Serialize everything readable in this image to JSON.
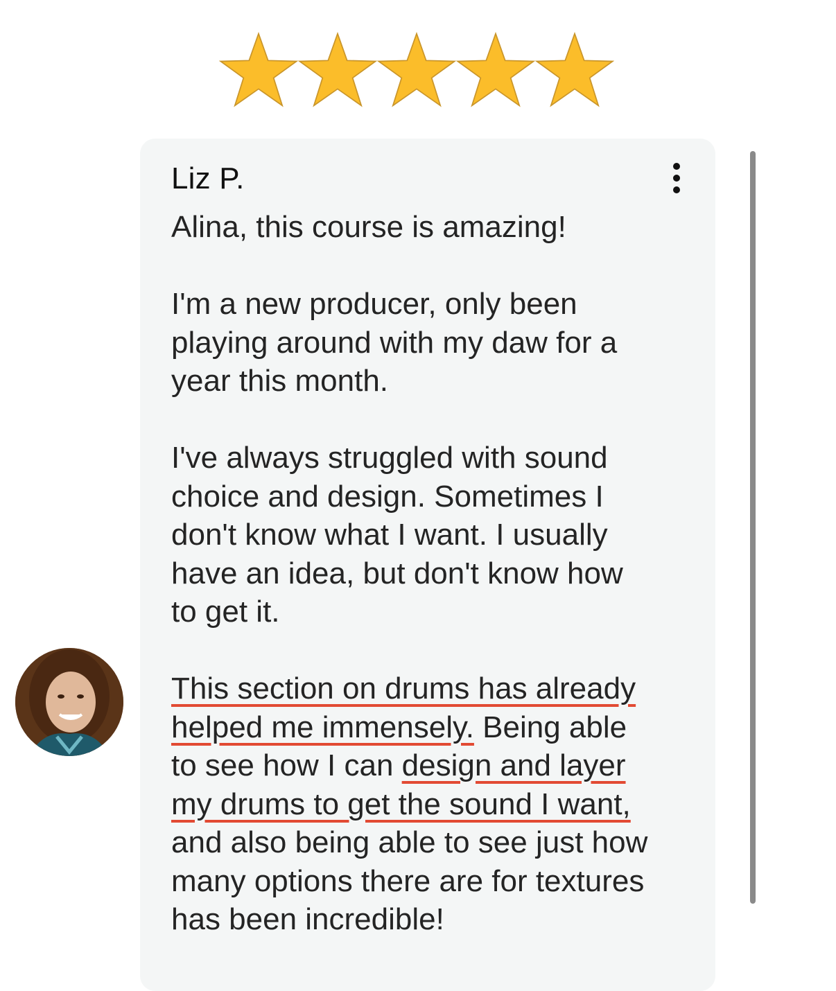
{
  "rating": {
    "stars_filled": 5,
    "stars_total": 5,
    "star_color": "#fbbd2a"
  },
  "review": {
    "author": "Liz P.",
    "menu_icon": "more-vertical-icon",
    "lines": [
      "Alina, this course is amazing!",
      "I'm a new producer, only been",
      "playing around with my daw for a",
      "year this month.",
      "I've always struggled with sound",
      "choice and design. Sometimes I",
      "don't know what I want. I usually",
      "have an idea, but don't know how",
      "to get it.",
      "This section on drums has already",
      "helped me immensely.",
      " Being able",
      "to see how I can ",
      "design and layer",
      "my drums to get the sound I want,",
      "and also being able to see just how",
      "many options there are for textures",
      "has been incredible!"
    ],
    "underline_color": "#e24a33"
  },
  "avatar": {
    "icon": "user-avatar-photo"
  },
  "colors": {
    "card_background": "#f4f6f6",
    "text": "#242424",
    "scrollbar": "#8a8a8a"
  }
}
